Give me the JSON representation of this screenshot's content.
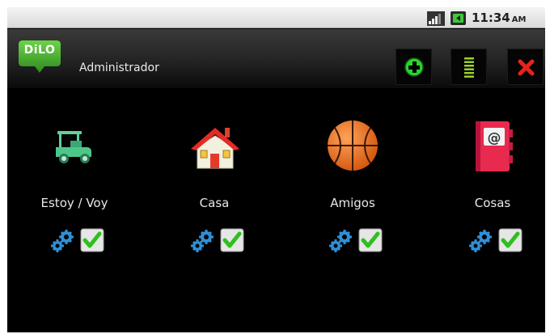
{
  "status_bar": {
    "time": "11:34",
    "ampm": "AM",
    "icons": [
      "signal-icon",
      "battery-icon"
    ]
  },
  "title_bar": {
    "logo_text": "DiLO",
    "title": "Administrador",
    "buttons": [
      {
        "name": "add-button",
        "icon": "plus-circle-icon",
        "color": "#2fd12f"
      },
      {
        "name": "list-button",
        "icon": "list-icon",
        "color": "#8fd12f"
      },
      {
        "name": "close-button",
        "icon": "close-icon",
        "color": "#e8231b"
      }
    ]
  },
  "items": [
    {
      "label": "Estoy / Voy",
      "icon": "golf-cart-icon"
    },
    {
      "label": "Casa",
      "icon": "house-icon"
    },
    {
      "label": "Amigos",
      "icon": "basketball-icon"
    },
    {
      "label": "Cosas",
      "icon": "address-book-icon"
    }
  ],
  "colors": {
    "logo_green": "#3fae2a",
    "check_green": "#2fbf1f",
    "gear_blue": "#2f8fd8"
  }
}
